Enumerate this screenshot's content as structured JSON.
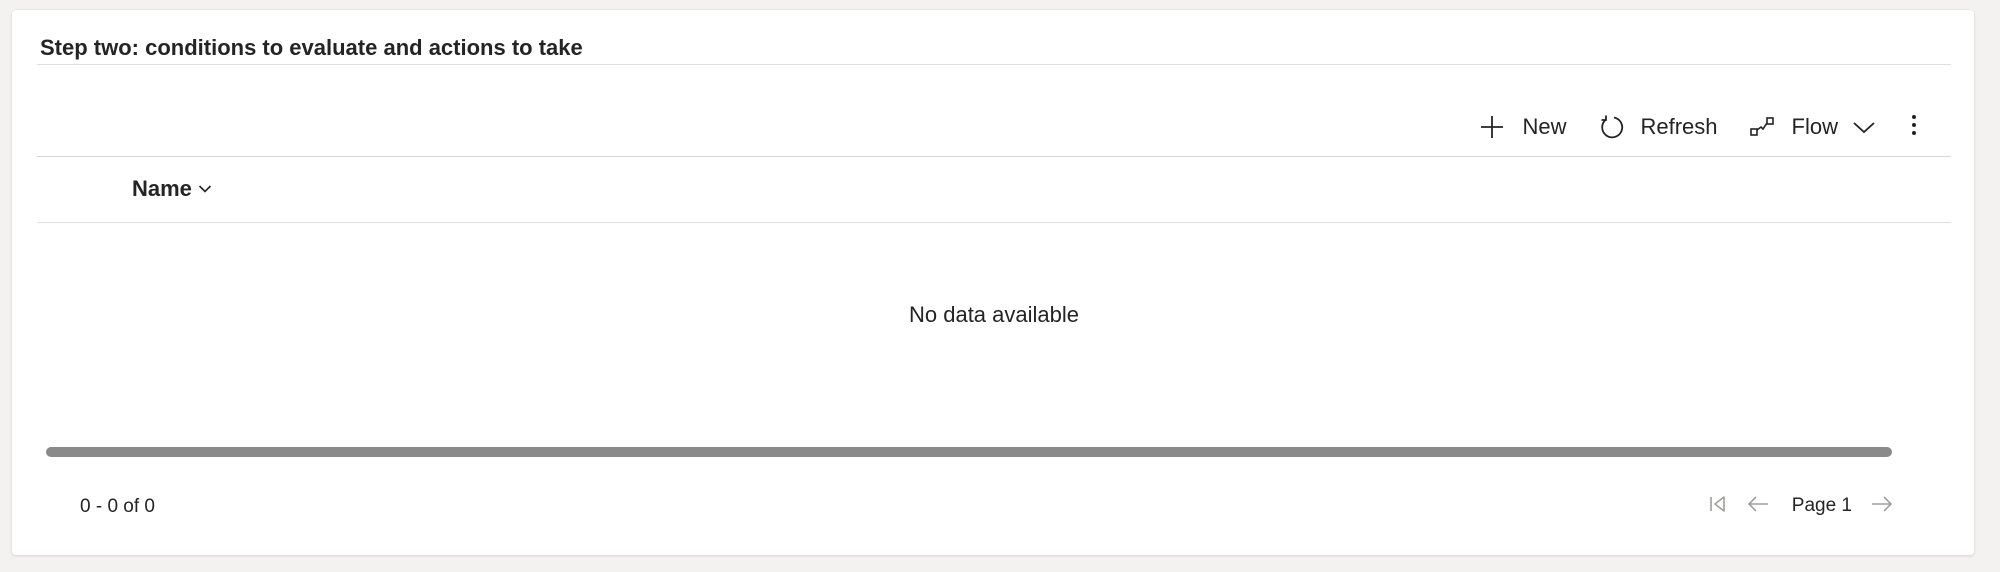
{
  "section": {
    "title": "Step two: conditions to evaluate and actions to take"
  },
  "toolbar": {
    "new_label": "New",
    "new_icon": "plus-icon",
    "refresh_label": "Refresh",
    "refresh_icon": "refresh-icon",
    "flow_label": "Flow",
    "flow_icon": "flow-icon",
    "more_icon": "more-vertical-icon"
  },
  "grid": {
    "columns": [
      {
        "label": "Name",
        "sort_icon": "chevron-down-icon"
      }
    ],
    "empty_message": "No data available",
    "record_count": "0 - 0 of 0"
  },
  "pager": {
    "page_label": "Page 1",
    "first_icon": "first-page-icon",
    "prev_icon": "arrow-left-icon",
    "next_icon": "arrow-right-icon"
  },
  "colors": {
    "card_bg": "#ffffff",
    "page_bg": "#f3f2f1",
    "text": "#242424",
    "disabled_icon": "#a19f9d",
    "scrollbar": "#8a8a8a"
  }
}
